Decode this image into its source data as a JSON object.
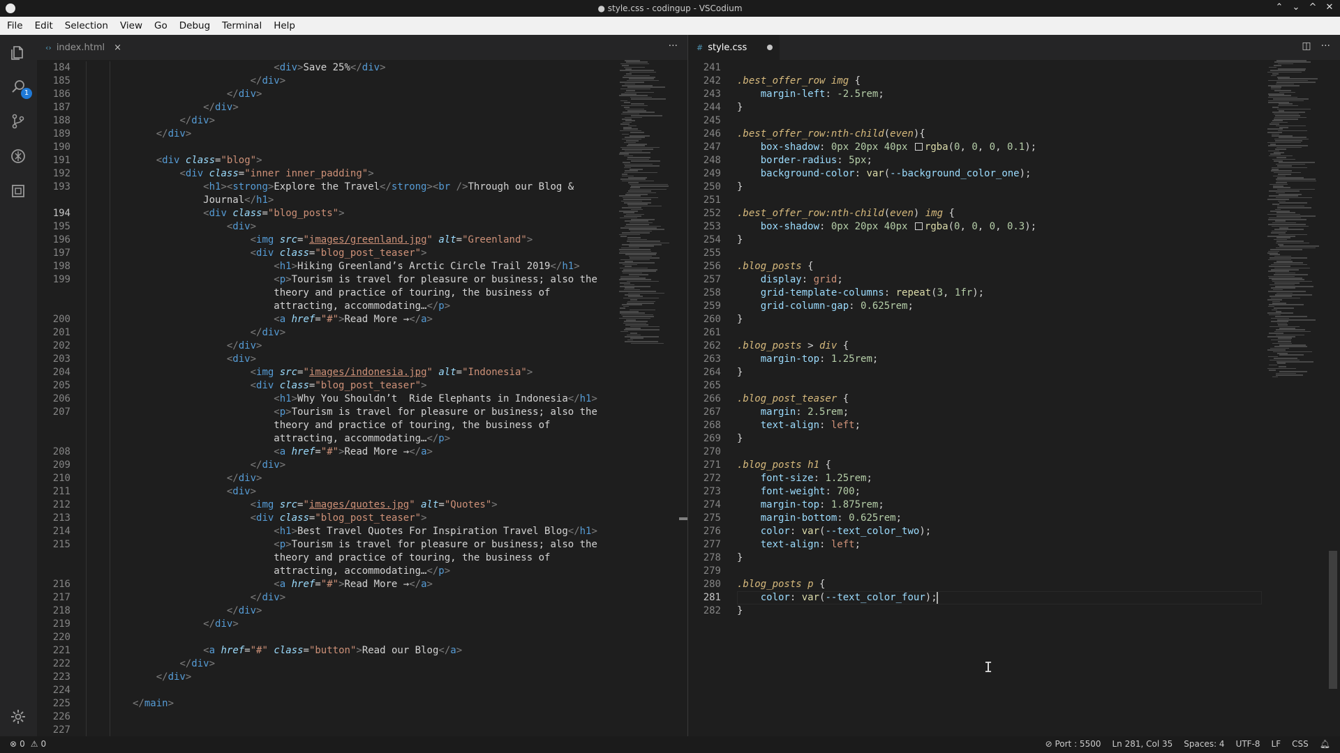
{
  "window": {
    "title": "● style.css - codingup - VSCodium"
  },
  "menu": [
    "File",
    "Edit",
    "Selection",
    "View",
    "Go",
    "Debug",
    "Terminal",
    "Help"
  ],
  "activity": {
    "scm_badge": "1",
    "icons": [
      "files-icon",
      "search-icon",
      "source-control-icon",
      "debug-icon",
      "extensions-icon",
      "gear-icon"
    ]
  },
  "left_editor": {
    "tab": {
      "label": "index.html",
      "icon": "‹›",
      "close": "×"
    },
    "current_line": "194",
    "lines": [
      {
        "n": "184",
        "h": "                        <span class='p'>&lt;</span><span class='t'>div</span><span class='p'>&gt;</span>Save 25%<span class='p'>&lt;/</span><span class='t'>div</span><span class='p'>&gt;</span>"
      },
      {
        "n": "185",
        "h": "                    <span class='p'>&lt;/</span><span class='t'>div</span><span class='p'>&gt;</span>"
      },
      {
        "n": "186",
        "h": "                <span class='p'>&lt;/</span><span class='t'>div</span><span class='p'>&gt;</span>"
      },
      {
        "n": "187",
        "h": "            <span class='p'>&lt;/</span><span class='t'>div</span><span class='p'>&gt;</span>"
      },
      {
        "n": "188",
        "h": "        <span class='p'>&lt;/</span><span class='t'>div</span><span class='p'>&gt;</span>"
      },
      {
        "n": "189",
        "h": "    <span class='p'>&lt;/</span><span class='t'>div</span><span class='p'>&gt;</span>"
      },
      {
        "n": "190",
        "h": ""
      },
      {
        "n": "191",
        "h": "    <span class='p'>&lt;</span><span class='t'>div</span> <span class='a'>class</span>=<span class='s'>\"blog\"</span><span class='p'>&gt;</span>"
      },
      {
        "n": "192",
        "h": "        <span class='p'>&lt;</span><span class='t'>div</span> <span class='a'>class</span>=<span class='s'>\"inner inner_padding\"</span><span class='p'>&gt;</span>"
      },
      {
        "n": "193",
        "h": "            <span class='p'>&lt;</span><span class='t'>h1</span><span class='p'>&gt;&lt;</span><span class='t'>strong</span><span class='p'>&gt;</span>Explore the Travel<span class='p'>&lt;/</span><span class='t'>strong</span><span class='p'>&gt;&lt;</span><span class='t'>br</span> <span class='p'>/&gt;</span>Through our Blog &amp;"
      },
      {
        "n": "",
        "h": "            Journal<span class='p'>&lt;/</span><span class='t'>h1</span><span class='p'>&gt;</span>"
      },
      {
        "n": "194",
        "h": "            <span class='p'>&lt;</span><span class='t'>div</span> <span class='a'>class</span>=<span class='s'>\"blog_posts\"</span><span class='p'>&gt;</span>"
      },
      {
        "n": "195",
        "h": "                <span class='p'>&lt;</span><span class='t'>div</span><span class='p'>&gt;</span>"
      },
      {
        "n": "196",
        "h": "                    <span class='p'>&lt;</span><span class='t'>img</span> <span class='a'>src</span>=<span class='s'>\"<span class='u'>images/greenland.jpg</span>\"</span> <span class='a'>alt</span>=<span class='s'>\"Greenland\"</span><span class='p'>&gt;</span>"
      },
      {
        "n": "197",
        "h": "                    <span class='p'>&lt;</span><span class='t'>div</span> <span class='a'>class</span>=<span class='s'>\"blog_post_teaser\"</span><span class='p'>&gt;</span>"
      },
      {
        "n": "198",
        "h": "                        <span class='p'>&lt;</span><span class='t'>h1</span><span class='p'>&gt;</span>Hiking Greenland’s Arctic Circle Trail 2019<span class='p'>&lt;/</span><span class='t'>h1</span><span class='p'>&gt;</span>"
      },
      {
        "n": "199",
        "h": "                        <span class='p'>&lt;</span><span class='t'>p</span><span class='p'>&gt;</span>Tourism is travel for pleasure or business; also the"
      },
      {
        "n": "",
        "h": "                        theory and practice of touring, the business of"
      },
      {
        "n": "",
        "h": "                        attracting, accommodating…<span class='p'>&lt;/</span><span class='t'>p</span><span class='p'>&gt;</span>"
      },
      {
        "n": "200",
        "h": "                        <span class='p'>&lt;</span><span class='t'>a</span> <span class='a'>href</span>=<span class='s'>\"#\"</span><span class='p'>&gt;</span>Read More →<span class='p'>&lt;/</span><span class='t'>a</span><span class='p'>&gt;</span>"
      },
      {
        "n": "201",
        "h": "                    <span class='p'>&lt;/</span><span class='t'>div</span><span class='p'>&gt;</span>"
      },
      {
        "n": "202",
        "h": "                <span class='p'>&lt;/</span><span class='t'>div</span><span class='p'>&gt;</span>"
      },
      {
        "n": "203",
        "h": "                <span class='p'>&lt;</span><span class='t'>div</span><span class='p'>&gt;</span>"
      },
      {
        "n": "204",
        "h": "                    <span class='p'>&lt;</span><span class='t'>img</span> <span class='a'>src</span>=<span class='s'>\"<span class='u'>images/indonesia.jpg</span>\"</span> <span class='a'>alt</span>=<span class='s'>\"Indonesia\"</span><span class='p'>&gt;</span>"
      },
      {
        "n": "205",
        "h": "                    <span class='p'>&lt;</span><span class='t'>div</span> <span class='a'>class</span>=<span class='s'>\"blog_post_teaser\"</span><span class='p'>&gt;</span>"
      },
      {
        "n": "206",
        "h": "                        <span class='p'>&lt;</span><span class='t'>h1</span><span class='p'>&gt;</span>Why You Shouldn’t  Ride Elephants in Indonesia<span class='p'>&lt;/</span><span class='t'>h1</span><span class='p'>&gt;</span>"
      },
      {
        "n": "207",
        "h": "                        <span class='p'>&lt;</span><span class='t'>p</span><span class='p'>&gt;</span>Tourism is travel for pleasure or business; also the"
      },
      {
        "n": "",
        "h": "                        theory and practice of touring, the business of"
      },
      {
        "n": "",
        "h": "                        attracting, accommodating…<span class='p'>&lt;/</span><span class='t'>p</span><span class='p'>&gt;</span>"
      },
      {
        "n": "208",
        "h": "                        <span class='p'>&lt;</span><span class='t'>a</span> <span class='a'>href</span>=<span class='s'>\"#\"</span><span class='p'>&gt;</span>Read More →<span class='p'>&lt;/</span><span class='t'>a</span><span class='p'>&gt;</span>"
      },
      {
        "n": "209",
        "h": "                    <span class='p'>&lt;/</span><span class='t'>div</span><span class='p'>&gt;</span>"
      },
      {
        "n": "210",
        "h": "                <span class='p'>&lt;/</span><span class='t'>div</span><span class='p'>&gt;</span>"
      },
      {
        "n": "211",
        "h": "                <span class='p'>&lt;</span><span class='t'>div</span><span class='p'>&gt;</span>"
      },
      {
        "n": "212",
        "h": "                    <span class='p'>&lt;</span><span class='t'>img</span> <span class='a'>src</span>=<span class='s'>\"<span class='u'>images/quotes.jpg</span>\"</span> <span class='a'>alt</span>=<span class='s'>\"Quotes\"</span><span class='p'>&gt;</span>"
      },
      {
        "n": "213",
        "h": "                    <span class='p'>&lt;</span><span class='t'>div</span> <span class='a'>class</span>=<span class='s'>\"blog_post_teaser\"</span><span class='p'>&gt;</span>"
      },
      {
        "n": "214",
        "h": "                        <span class='p'>&lt;</span><span class='t'>h1</span><span class='p'>&gt;</span>Best Travel Quotes For Inspiration Travel Blog<span class='p'>&lt;/</span><span class='t'>h1</span><span class='p'>&gt;</span>"
      },
      {
        "n": "215",
        "h": "                        <span class='p'>&lt;</span><span class='t'>p</span><span class='p'>&gt;</span>Tourism is travel for pleasure or business; also the"
      },
      {
        "n": "",
        "h": "                        theory and practice of touring, the business of"
      },
      {
        "n": "",
        "h": "                        attracting, accommodating…<span class='p'>&lt;/</span><span class='t'>p</span><span class='p'>&gt;</span>"
      },
      {
        "n": "216",
        "h": "                        <span class='p'>&lt;</span><span class='t'>a</span> <span class='a'>href</span>=<span class='s'>\"#\"</span><span class='p'>&gt;</span>Read More →<span class='p'>&lt;/</span><span class='t'>a</span><span class='p'>&gt;</span>"
      },
      {
        "n": "217",
        "h": "                    <span class='p'>&lt;/</span><span class='t'>div</span><span class='p'>&gt;</span>"
      },
      {
        "n": "218",
        "h": "                <span class='p'>&lt;/</span><span class='t'>div</span><span class='p'>&gt;</span>"
      },
      {
        "n": "219",
        "h": "            <span class='p'>&lt;/</span><span class='t'>div</span><span class='p'>&gt;</span>"
      },
      {
        "n": "220",
        "h": ""
      },
      {
        "n": "221",
        "h": "            <span class='p'>&lt;</span><span class='t'>a</span> <span class='a'>href</span>=<span class='s'>\"#\"</span> <span class='a'>class</span>=<span class='s'>\"button\"</span><span class='p'>&gt;</span>Read our Blog<span class='p'>&lt;/</span><span class='t'>a</span><span class='p'>&gt;</span>"
      },
      {
        "n": "222",
        "h": "        <span class='p'>&lt;/</span><span class='t'>div</span><span class='p'>&gt;</span>"
      },
      {
        "n": "223",
        "h": "    <span class='p'>&lt;/</span><span class='t'>div</span><span class='p'>&gt;</span>"
      },
      {
        "n": "224",
        "h": ""
      },
      {
        "n": "225",
        "h": "<span class='p'>&lt;/</span><span class='t'>main</span><span class='p'>&gt;</span>"
      },
      {
        "n": "226",
        "h": ""
      },
      {
        "n": "227",
        "h": ""
      }
    ]
  },
  "right_editor": {
    "tab": {
      "label": "style.css",
      "icon": "#"
    },
    "current_line": "281",
    "lines": [
      {
        "n": "241",
        "h": ""
      },
      {
        "n": "242",
        "h": "<span class='sel'>.best_offer_row img</span> {"
      },
      {
        "n": "243",
        "h": "    <span class='pr'>margin-left</span>: <span class='n'>-2.5rem</span>;"
      },
      {
        "n": "244",
        "h": "}"
      },
      {
        "n": "245",
        "h": ""
      },
      {
        "n": "246",
        "h": "<span class='sel'>.best_offer_row:nth-child</span>(<span class='sel'>even</span>){"
      },
      {
        "n": "247",
        "h": "    <span class='pr'>box-shadow</span>: <span class='n'>0px 20px 40px</span> <span class='swatch'></span><span class='f'>rgba</span>(<span class='n'>0</span>, <span class='n'>0</span>, <span class='n'>0</span>, <span class='n'>0.1</span>);"
      },
      {
        "n": "248",
        "h": "    <span class='pr'>border-radius</span>: <span class='n'>5px</span>;"
      },
      {
        "n": "249",
        "h": "    <span class='pr'>background-color</span>: <span class='f'>var</span>(<span class='v'>--background_color_one</span>);"
      },
      {
        "n": "250",
        "h": "}"
      },
      {
        "n": "251",
        "h": ""
      },
      {
        "n": "252",
        "h": "<span class='sel'>.best_offer_row:nth-child</span>(<span class='sel'>even</span>) <span class='sel'>img</span> {"
      },
      {
        "n": "253",
        "h": "    <span class='pr'>box-shadow</span>: <span class='n'>0px 20px 40px</span> <span class='swatch'></span><span class='f'>rgba</span>(<span class='n'>0</span>, <span class='n'>0</span>, <span class='n'>0</span>, <span class='n'>0.3</span>);"
      },
      {
        "n": "254",
        "h": "}"
      },
      {
        "n": "255",
        "h": ""
      },
      {
        "n": "256",
        "h": "<span class='sel'>.blog_posts</span> {"
      },
      {
        "n": "257",
        "h": "    <span class='pr'>display</span>: <span class='s'>grid</span>;"
      },
      {
        "n": "258",
        "h": "    <span class='pr'>grid-template-columns</span>: <span class='f'>repeat</span>(<span class='n'>3</span>, <span class='n'>1fr</span>);"
      },
      {
        "n": "259",
        "h": "    <span class='pr'>grid-column-gap</span>: <span class='n'>0.625rem</span>;"
      },
      {
        "n": "260",
        "h": "}"
      },
      {
        "n": "261",
        "h": ""
      },
      {
        "n": "262",
        "h": "<span class='sel'>.blog_posts</span> &gt; <span class='sel'>div</span> {"
      },
      {
        "n": "263",
        "h": "    <span class='pr'>margin-top</span>: <span class='n'>1.25rem</span>;"
      },
      {
        "n": "264",
        "h": "}"
      },
      {
        "n": "265",
        "h": ""
      },
      {
        "n": "266",
        "h": "<span class='sel'>.blog_post_teaser</span> {"
      },
      {
        "n": "267",
        "h": "    <span class='pr'>margin</span>: <span class='n'>2.5rem</span>;"
      },
      {
        "n": "268",
        "h": "    <span class='pr'>text-align</span>: <span class='s'>left</span>;"
      },
      {
        "n": "269",
        "h": "}"
      },
      {
        "n": "270",
        "h": ""
      },
      {
        "n": "271",
        "h": "<span class='sel'>.blog_posts h1</span> {"
      },
      {
        "n": "272",
        "h": "    <span class='pr'>font-size</span>: <span class='n'>1.25rem</span>;"
      },
      {
        "n": "273",
        "h": "    <span class='pr'>font-weight</span>: <span class='n'>700</span>;"
      },
      {
        "n": "274",
        "h": "    <span class='pr'>margin-top</span>: <span class='n'>1.875rem</span>;"
      },
      {
        "n": "275",
        "h": "    <span class='pr'>margin-bottom</span>: <span class='n'>0.625rem</span>;"
      },
      {
        "n": "276",
        "h": "    <span class='pr'>color</span>: <span class='f'>var</span>(<span class='v'>--text_color_two</span>);"
      },
      {
        "n": "277",
        "h": "    <span class='pr'>text-align</span>: <span class='s'>left</span>;"
      },
      {
        "n": "278",
        "h": "}"
      },
      {
        "n": "279",
        "h": ""
      },
      {
        "n": "280",
        "h": "<span class='sel'>.blog_posts p</span> {"
      },
      {
        "n": "281",
        "h": "    <span class='pr'>color</span>: <span class='f'>var</span>(<span class='v'>--text_color_four</span>);"
      },
      {
        "n": "282",
        "h": "}"
      }
    ]
  },
  "status": {
    "errors": "0",
    "warnings": "0",
    "port": "Port : 5500",
    "position": "Ln 281, Col 35",
    "spaces": "Spaces: 4",
    "encoding": "UTF-8",
    "eol": "LF",
    "language": "CSS"
  }
}
